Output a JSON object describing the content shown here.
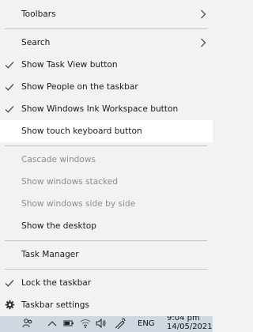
{
  "menu": {
    "toolbars": "Toolbars",
    "search": "Search",
    "show_task_view": "Show Task View button",
    "show_people": "Show People on the taskbar",
    "show_ink": "Show Windows Ink Workspace button",
    "show_touch_keyboard": "Show touch keyboard button",
    "cascade": "Cascade windows",
    "stacked": "Show windows stacked",
    "side_by_side": "Show windows side by side",
    "show_desktop": "Show the desktop",
    "task_manager": "Task Manager",
    "lock_taskbar": "Lock the taskbar",
    "taskbar_settings": "Taskbar settings"
  },
  "taskbar": {
    "language": "ENG",
    "time": "9:04 pm",
    "date": "14/05/2021"
  },
  "colors": {
    "menu_bg": "#f2f2f2",
    "hover_bg": "#ffffff",
    "disabled_text": "#8c8c8c",
    "taskbar_bg": "#cfd7e0"
  }
}
